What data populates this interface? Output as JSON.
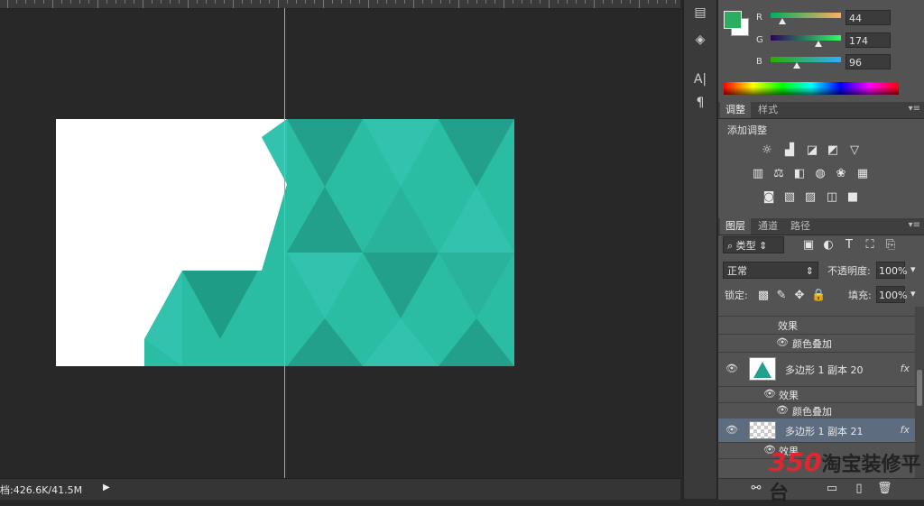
{
  "status": {
    "doc_size": "档:426.6K/41.5M"
  },
  "color_panel": {
    "channels": [
      {
        "label": "R",
        "value": "44",
        "thumb": 0.17
      },
      {
        "label": "G",
        "value": "174",
        "thumb": 0.68
      },
      {
        "label": "B",
        "value": "96",
        "thumb": 0.38
      }
    ],
    "foreground": "#2cae60",
    "background": "#ffffff"
  },
  "adjust_panel": {
    "tabs": [
      "调整",
      "样式"
    ],
    "title": "添加调整"
  },
  "layers_panel": {
    "tabs": [
      "图层",
      "通道",
      "路径"
    ],
    "filter_label": "类型",
    "blend_mode": "正常",
    "opacity_label": "不透明度:",
    "opacity_value": "100%",
    "lock_label": "锁定:",
    "fill_label": "填充:",
    "fill_value": "100%",
    "rows": [
      {
        "type": "sub",
        "name": "效果"
      },
      {
        "type": "sub2",
        "name": "颜色叠加"
      },
      {
        "type": "layer",
        "name": "多边形 1 副本 20",
        "fx": "fx"
      },
      {
        "type": "sub",
        "name": "效果"
      },
      {
        "type": "sub2",
        "name": "颜色叠加"
      },
      {
        "type": "layer",
        "name": "多边形 1 副本 21",
        "fx": "fx"
      },
      {
        "type": "sub",
        "name": "效果"
      }
    ]
  },
  "watermark": {
    "num": "350",
    "text": "淘宝装修平台"
  },
  "colors": {
    "teal_1": "#22a08b",
    "teal_2": "#2bbda4",
    "teal_3": "#33c2ad",
    "guide": "#2fd9d6"
  }
}
